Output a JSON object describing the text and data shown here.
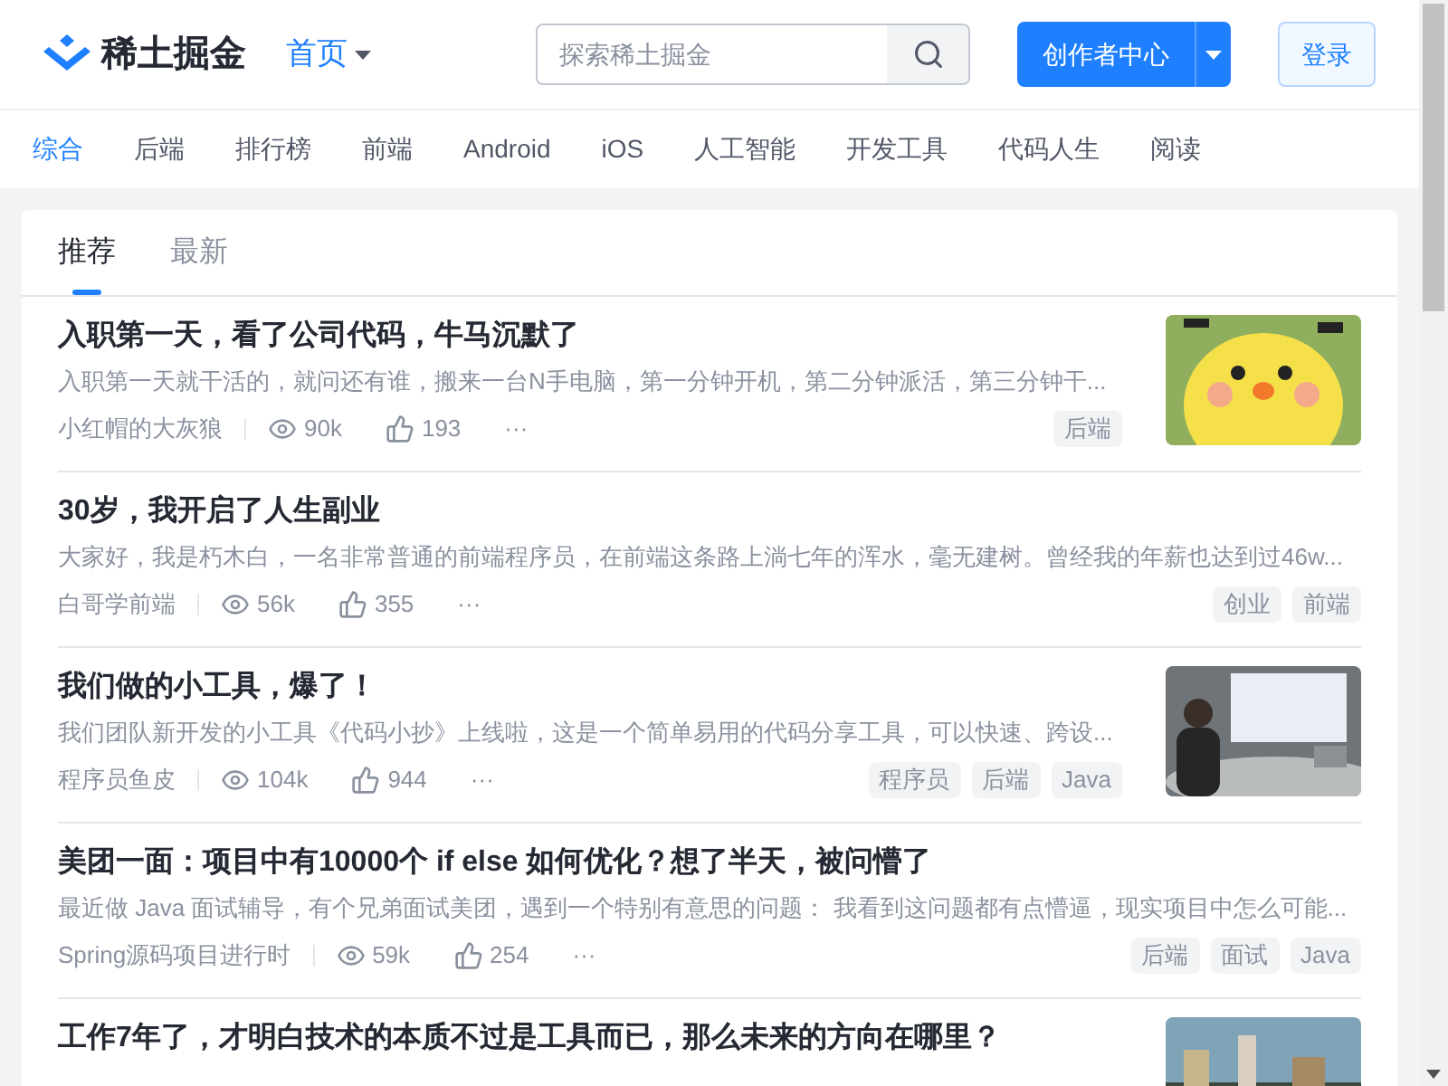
{
  "header": {
    "logo": "稀土掘金",
    "home_menu": "首页",
    "search": {
      "placeholder": "探索稀土掘金"
    },
    "creator_button": "创作者中心",
    "login_button": "登录"
  },
  "categories": [
    {
      "label": "综合",
      "selected": true
    },
    {
      "label": "后端",
      "selected": false
    },
    {
      "label": "排行榜",
      "selected": false
    },
    {
      "label": "前端",
      "selected": false
    },
    {
      "label": "Android",
      "selected": false
    },
    {
      "label": "iOS",
      "selected": false
    },
    {
      "label": "人工智能",
      "selected": false
    },
    {
      "label": "开发工具",
      "selected": false
    },
    {
      "label": "代码人生",
      "selected": false
    },
    {
      "label": "阅读",
      "selected": false
    }
  ],
  "feed_tabs": [
    {
      "label": "推荐",
      "selected": true
    },
    {
      "label": "最新",
      "selected": false
    }
  ],
  "articles": [
    {
      "title": "入职第一天，看了公司代码，牛马沉默了",
      "abstract": "入职第一天就干活的，就问还有谁，搬来一台N手电脑，第一分钟开机，第二分钟派活，第三分钟干...",
      "author": "小红帽的大灰狼",
      "views": "90k",
      "likes": "193",
      "more": "···",
      "tags": [
        "后端"
      ],
      "thumbnail": {
        "kind": "picture"
      }
    },
    {
      "title": "30岁，我开启了人生副业",
      "abstract": "大家好，我是朽木白，一名非常普通的前端程序员，在前端这条路上淌七年的浑水，毫无建树。曾经我的年薪也达到过46w...",
      "author": "白哥学前端",
      "views": "56k",
      "likes": "355",
      "more": "···",
      "tags": [
        "创业",
        "前端"
      ]
    },
    {
      "title": "我们做的小工具，爆了！",
      "abstract": "我们团队新开发的小工具《代码小抄》上线啦，这是一个简单易用的代码分享工具，可以快速、跨设...",
      "author": "程序员鱼皮",
      "views": "104k",
      "likes": "944",
      "more": "···",
      "tags": [
        "程序员",
        "后端",
        "Java"
      ],
      "thumbnail": {
        "kind": "picture"
      }
    },
    {
      "title": "美团一面：项目中有10000个 if else 如何优化？想了半天，被问懵了",
      "abstract": "最近做 Java 面试辅导，有个兄弟面试美团，遇到一个特别有意思的问题： 我看到这问题都有点懵逼，现实项目中怎么可能...",
      "author": "Spring源码项目进行时",
      "views": "59k",
      "likes": "254",
      "more": "···",
      "tags": [
        "后端",
        "面试",
        "Java"
      ]
    },
    {
      "title": "工作7年了，才明白技术的本质不过是工具而已，那么未来的方向在哪里？",
      "thumbnail": {
        "kind": "picture"
      }
    }
  ]
}
